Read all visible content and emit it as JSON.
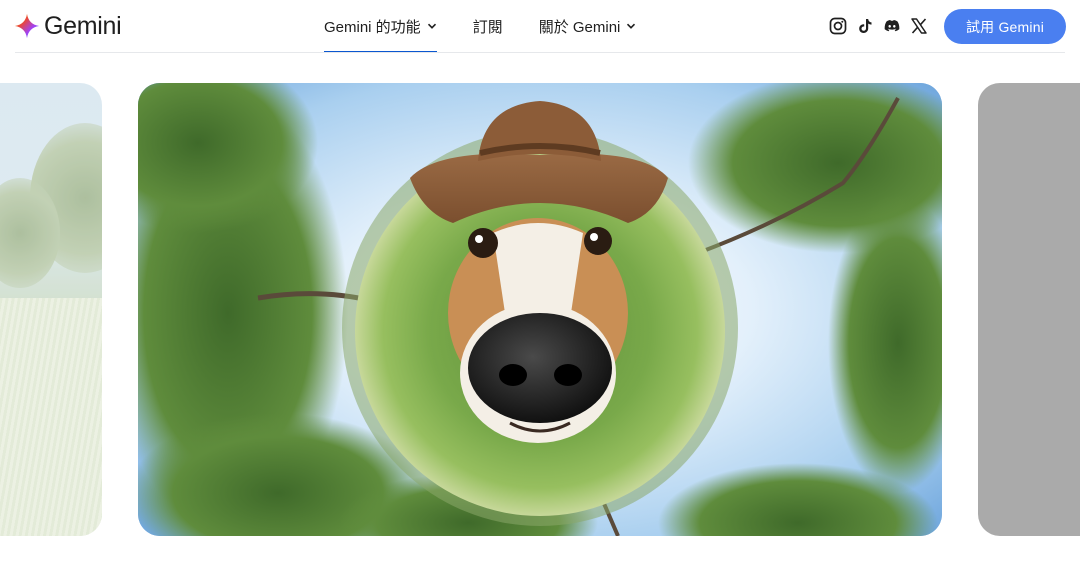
{
  "header": {
    "brand": "Gemini",
    "nav": [
      {
        "label": "Gemini 的功能",
        "has_dropdown": true,
        "active": true
      },
      {
        "label": "訂閱",
        "has_dropdown": false,
        "active": false
      },
      {
        "label": "關於 Gemini",
        "has_dropdown": true,
        "active": false
      }
    ],
    "social_icons": [
      "instagram-icon",
      "tiktok-icon",
      "discord-icon",
      "x-icon"
    ],
    "cta_label": "試用 Gemini"
  },
  "colors": {
    "accent": "#0b57d0",
    "cta_background": "#4a7ff0",
    "next_slide_placeholder": "#aaaaaa"
  },
  "carousel": {
    "main_image": "dog-wearing-cowboy-hat-tiny-planet-photo",
    "prev_image": "golf-course-trees-photo",
    "next_image": "gray-placeholder"
  }
}
